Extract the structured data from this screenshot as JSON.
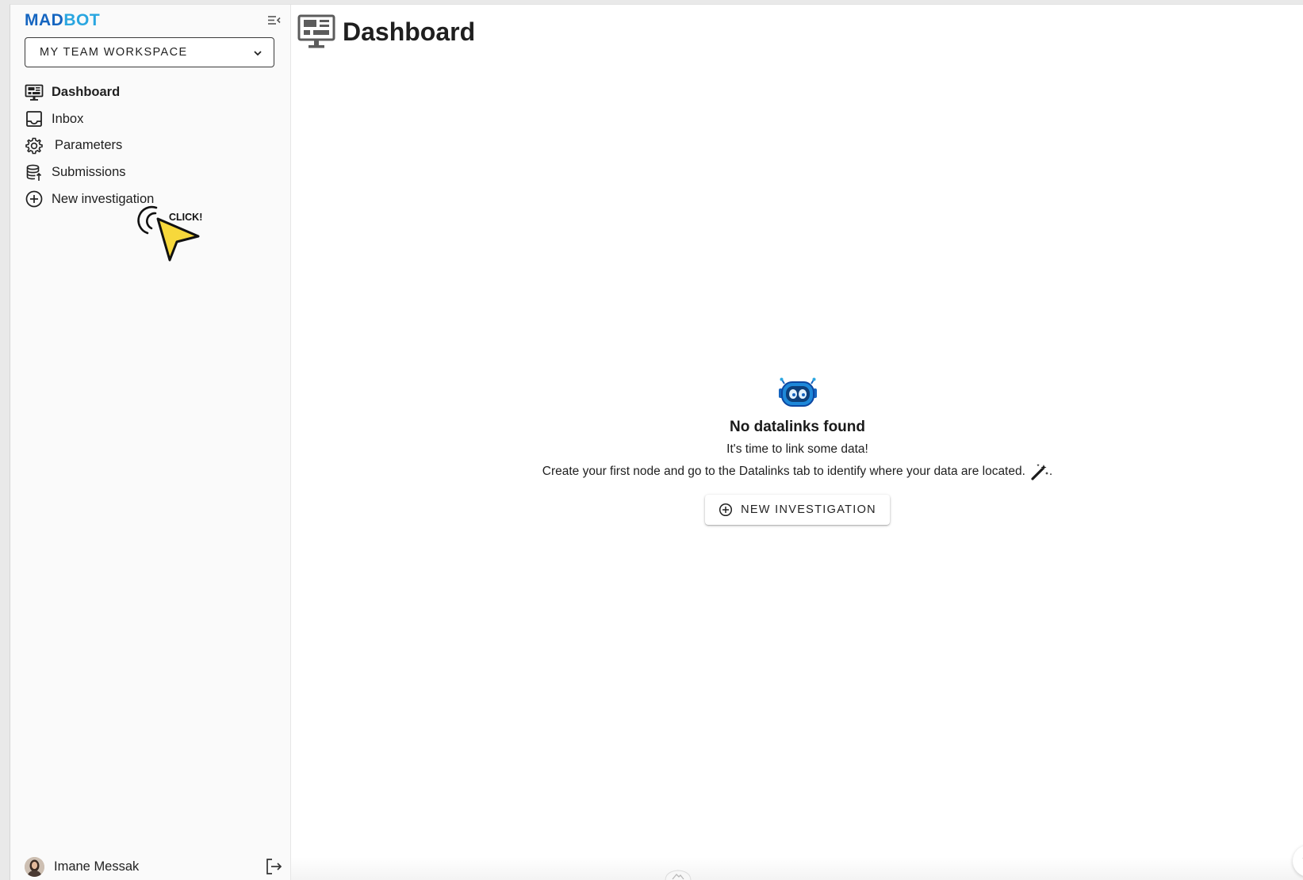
{
  "app": {
    "logo_part1": "MAD",
    "logo_part2": "BOT"
  },
  "colors": {
    "brand_dark": "#1565c0",
    "brand_light": "#29a6e0",
    "cursor_yellow": "#f7d83b"
  },
  "sidebar": {
    "workspace_label": "MY TEAM WORKSPACE",
    "items": [
      {
        "label": "Dashboard",
        "icon": "dashboard-icon",
        "active": true
      },
      {
        "label": "Inbox",
        "icon": "inbox-icon"
      },
      {
        "label": "Parameters",
        "icon": "gear-icon"
      },
      {
        "label": "Submissions",
        "icon": "database-upload-icon"
      },
      {
        "label": "New investigation",
        "icon": "add-circle-icon"
      }
    ],
    "cursor_label": "CLICK!",
    "user_name": "Imane Messak"
  },
  "main": {
    "title": "Dashboard",
    "empty_state": {
      "title": "No datalinks found",
      "subtitle": "It's time to link some data!",
      "description": "Create your first node and go to the Datalinks tab to identify where your data are located.",
      "description_suffix": ".",
      "button_label": "NEW INVESTIGATION"
    },
    "help_label": "?"
  }
}
